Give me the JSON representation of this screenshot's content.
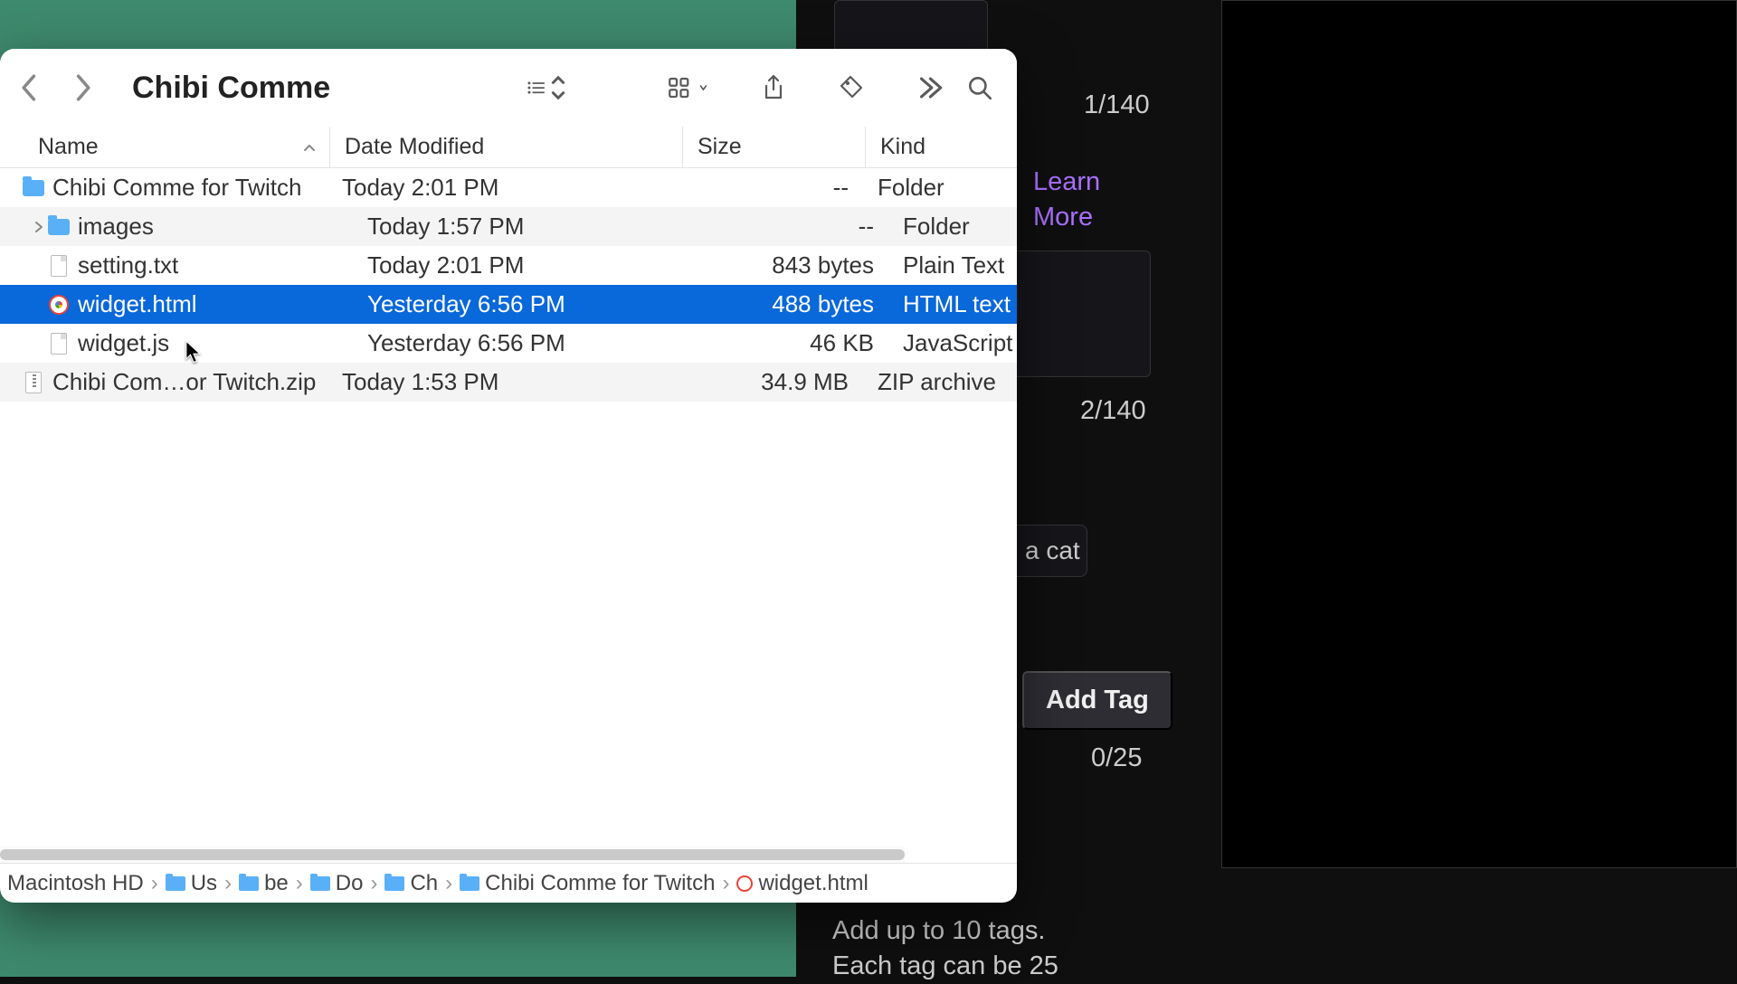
{
  "window": {
    "title": "Chibi Comme"
  },
  "columns": {
    "name": "Name",
    "date": "Date Modified",
    "size": "Size",
    "kind": "Kind"
  },
  "files": [
    {
      "name": "Chibi Comme for Twitch",
      "date": "Today 2:01 PM",
      "size": "--",
      "kind": "Folder",
      "icon": "folder",
      "indent": 0,
      "expanded": false,
      "selected": false
    },
    {
      "name": "images",
      "date": "Today 1:57 PM",
      "size": "--",
      "kind": "Folder",
      "icon": "folder",
      "indent": 1,
      "expanded": false,
      "selected": false,
      "disclosure": true
    },
    {
      "name": "setting.txt",
      "date": "Today 2:01 PM",
      "size": "843 bytes",
      "kind": "Plain Text",
      "icon": "doc",
      "indent": 1,
      "selected": false
    },
    {
      "name": "widget.html",
      "date": "Yesterday 6:56 PM",
      "size": "488 bytes",
      "kind": "HTML text",
      "icon": "html",
      "indent": 1,
      "selected": true
    },
    {
      "name": "widget.js",
      "date": "Yesterday 6:56 PM",
      "size": "46 KB",
      "kind": "JavaScript s",
      "icon": "doc",
      "indent": 1,
      "selected": false
    },
    {
      "name": "Chibi Com…or Twitch.zip",
      "date": "Today 1:53 PM",
      "size": "34.9 MB",
      "kind": "ZIP archive",
      "icon": "zip",
      "indent": 0,
      "selected": false
    }
  ],
  "path": {
    "segments": [
      {
        "label": "Macintosh HD",
        "icon": "none"
      },
      {
        "label": "Us",
        "icon": "folder"
      },
      {
        "label": "be",
        "icon": "folder"
      },
      {
        "label": "Do",
        "icon": "folder"
      },
      {
        "label": "Ch",
        "icon": "folder"
      },
      {
        "label": "Chibi Comme for Twitch",
        "icon": "folder"
      },
      {
        "label": "widget.html",
        "icon": "file"
      }
    ]
  },
  "side": {
    "counter1": "1/140",
    "learn_more": "Learn More",
    "counter2": "2/140",
    "cat": "a cat",
    "add_tag": "Add Tag",
    "counter3": "0/25",
    "help1": "Add up to 10 tags.",
    "help2": "Each tag can be 25"
  }
}
